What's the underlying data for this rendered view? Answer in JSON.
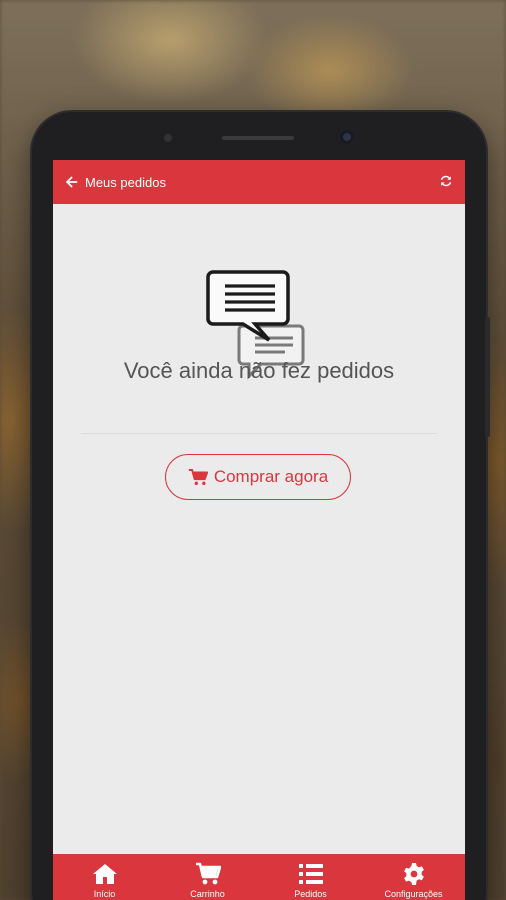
{
  "header": {
    "title": "Meus pedidos",
    "back_icon": "arrow-left-icon",
    "refresh_icon": "refresh-icon"
  },
  "empty_state": {
    "icon": "chat-bubbles-icon",
    "message": "Você ainda não fez pedidos",
    "button_label": "Comprar agora",
    "button_icon": "cart-icon"
  },
  "bottom_nav": {
    "items": [
      {
        "label": "Início",
        "icon": "home-icon"
      },
      {
        "label": "Carrinho",
        "icon": "cart-icon"
      },
      {
        "label": "Pedidos",
        "icon": "list-icon"
      },
      {
        "label": "Configurações",
        "icon": "gear-icon"
      }
    ]
  },
  "colors": {
    "accent": "#d9363e",
    "background": "#ebebeb",
    "text": "#555555"
  }
}
